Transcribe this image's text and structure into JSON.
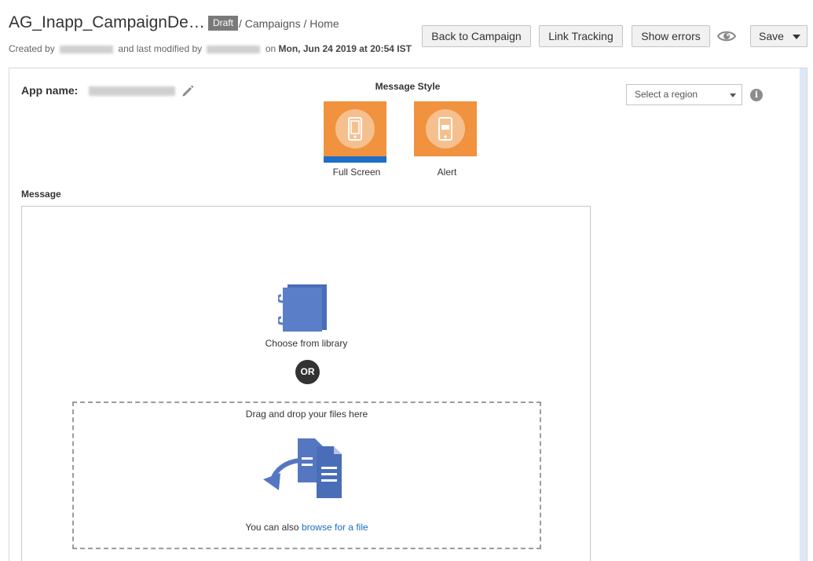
{
  "header": {
    "title": "AG_Inapp_CampaignDe…",
    "status_badge": "Draft",
    "breadcrumb": "/ Campaigns / Home",
    "meta": {
      "created_by_prefix": "Created by",
      "modified_by_text": "and last modified by",
      "on_text": "on",
      "modified_date": "Mon, Jun 24 2019 at 20:54 IST"
    },
    "buttons": {
      "back": "Back to Campaign",
      "link_tracking": "Link Tracking",
      "show_errors": "Show errors",
      "save": "Save"
    }
  },
  "form": {
    "app_name_label": "App name:",
    "message_style_label": "Message Style",
    "styles": [
      {
        "label": "Full Screen",
        "selected": true
      },
      {
        "label": "Alert",
        "selected": false
      }
    ],
    "region_select_value": "Select a region",
    "message_label": "Message"
  },
  "message": {
    "library_label": "Choose from library",
    "or_label": "OR",
    "drop_label": "Drag and drop your files here",
    "browse_prefix": "You can also",
    "browse_link": "browse for a file"
  },
  "colors": {
    "tile_orange": "#f0923e",
    "selected_blue": "#1e6fc8",
    "icon_blue": "#5577c2",
    "link_blue": "#1a6fc4"
  }
}
